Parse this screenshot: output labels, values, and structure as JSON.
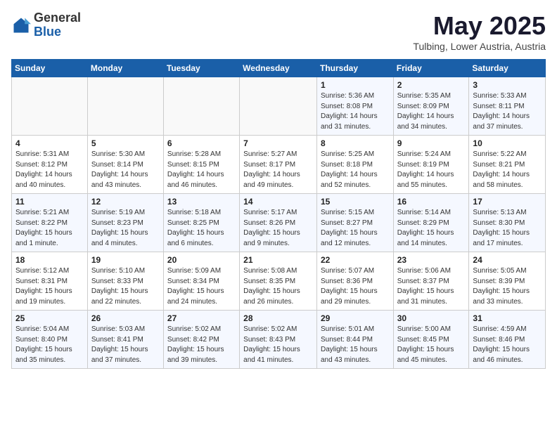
{
  "header": {
    "logo_general": "General",
    "logo_blue": "Blue",
    "month_title": "May 2025",
    "location": "Tulbing, Lower Austria, Austria"
  },
  "days_of_week": [
    "Sunday",
    "Monday",
    "Tuesday",
    "Wednesday",
    "Thursday",
    "Friday",
    "Saturday"
  ],
  "weeks": [
    [
      {
        "day": "",
        "info": ""
      },
      {
        "day": "",
        "info": ""
      },
      {
        "day": "",
        "info": ""
      },
      {
        "day": "",
        "info": ""
      },
      {
        "day": "1",
        "info": "Sunrise: 5:36 AM\nSunset: 8:08 PM\nDaylight: 14 hours\nand 31 minutes."
      },
      {
        "day": "2",
        "info": "Sunrise: 5:35 AM\nSunset: 8:09 PM\nDaylight: 14 hours\nand 34 minutes."
      },
      {
        "day": "3",
        "info": "Sunrise: 5:33 AM\nSunset: 8:11 PM\nDaylight: 14 hours\nand 37 minutes."
      }
    ],
    [
      {
        "day": "4",
        "info": "Sunrise: 5:31 AM\nSunset: 8:12 PM\nDaylight: 14 hours\nand 40 minutes."
      },
      {
        "day": "5",
        "info": "Sunrise: 5:30 AM\nSunset: 8:14 PM\nDaylight: 14 hours\nand 43 minutes."
      },
      {
        "day": "6",
        "info": "Sunrise: 5:28 AM\nSunset: 8:15 PM\nDaylight: 14 hours\nand 46 minutes."
      },
      {
        "day": "7",
        "info": "Sunrise: 5:27 AM\nSunset: 8:17 PM\nDaylight: 14 hours\nand 49 minutes."
      },
      {
        "day": "8",
        "info": "Sunrise: 5:25 AM\nSunset: 8:18 PM\nDaylight: 14 hours\nand 52 minutes."
      },
      {
        "day": "9",
        "info": "Sunrise: 5:24 AM\nSunset: 8:19 PM\nDaylight: 14 hours\nand 55 minutes."
      },
      {
        "day": "10",
        "info": "Sunrise: 5:22 AM\nSunset: 8:21 PM\nDaylight: 14 hours\nand 58 minutes."
      }
    ],
    [
      {
        "day": "11",
        "info": "Sunrise: 5:21 AM\nSunset: 8:22 PM\nDaylight: 15 hours\nand 1 minute."
      },
      {
        "day": "12",
        "info": "Sunrise: 5:19 AM\nSunset: 8:23 PM\nDaylight: 15 hours\nand 4 minutes."
      },
      {
        "day": "13",
        "info": "Sunrise: 5:18 AM\nSunset: 8:25 PM\nDaylight: 15 hours\nand 6 minutes."
      },
      {
        "day": "14",
        "info": "Sunrise: 5:17 AM\nSunset: 8:26 PM\nDaylight: 15 hours\nand 9 minutes."
      },
      {
        "day": "15",
        "info": "Sunrise: 5:15 AM\nSunset: 8:27 PM\nDaylight: 15 hours\nand 12 minutes."
      },
      {
        "day": "16",
        "info": "Sunrise: 5:14 AM\nSunset: 8:29 PM\nDaylight: 15 hours\nand 14 minutes."
      },
      {
        "day": "17",
        "info": "Sunrise: 5:13 AM\nSunset: 8:30 PM\nDaylight: 15 hours\nand 17 minutes."
      }
    ],
    [
      {
        "day": "18",
        "info": "Sunrise: 5:12 AM\nSunset: 8:31 PM\nDaylight: 15 hours\nand 19 minutes."
      },
      {
        "day": "19",
        "info": "Sunrise: 5:10 AM\nSunset: 8:33 PM\nDaylight: 15 hours\nand 22 minutes."
      },
      {
        "day": "20",
        "info": "Sunrise: 5:09 AM\nSunset: 8:34 PM\nDaylight: 15 hours\nand 24 minutes."
      },
      {
        "day": "21",
        "info": "Sunrise: 5:08 AM\nSunset: 8:35 PM\nDaylight: 15 hours\nand 26 minutes."
      },
      {
        "day": "22",
        "info": "Sunrise: 5:07 AM\nSunset: 8:36 PM\nDaylight: 15 hours\nand 29 minutes."
      },
      {
        "day": "23",
        "info": "Sunrise: 5:06 AM\nSunset: 8:37 PM\nDaylight: 15 hours\nand 31 minutes."
      },
      {
        "day": "24",
        "info": "Sunrise: 5:05 AM\nSunset: 8:39 PM\nDaylight: 15 hours\nand 33 minutes."
      }
    ],
    [
      {
        "day": "25",
        "info": "Sunrise: 5:04 AM\nSunset: 8:40 PM\nDaylight: 15 hours\nand 35 minutes."
      },
      {
        "day": "26",
        "info": "Sunrise: 5:03 AM\nSunset: 8:41 PM\nDaylight: 15 hours\nand 37 minutes."
      },
      {
        "day": "27",
        "info": "Sunrise: 5:02 AM\nSunset: 8:42 PM\nDaylight: 15 hours\nand 39 minutes."
      },
      {
        "day": "28",
        "info": "Sunrise: 5:02 AM\nSunset: 8:43 PM\nDaylight: 15 hours\nand 41 minutes."
      },
      {
        "day": "29",
        "info": "Sunrise: 5:01 AM\nSunset: 8:44 PM\nDaylight: 15 hours\nand 43 minutes."
      },
      {
        "day": "30",
        "info": "Sunrise: 5:00 AM\nSunset: 8:45 PM\nDaylight: 15 hours\nand 45 minutes."
      },
      {
        "day": "31",
        "info": "Sunrise: 4:59 AM\nSunset: 8:46 PM\nDaylight: 15 hours\nand 46 minutes."
      }
    ]
  ]
}
